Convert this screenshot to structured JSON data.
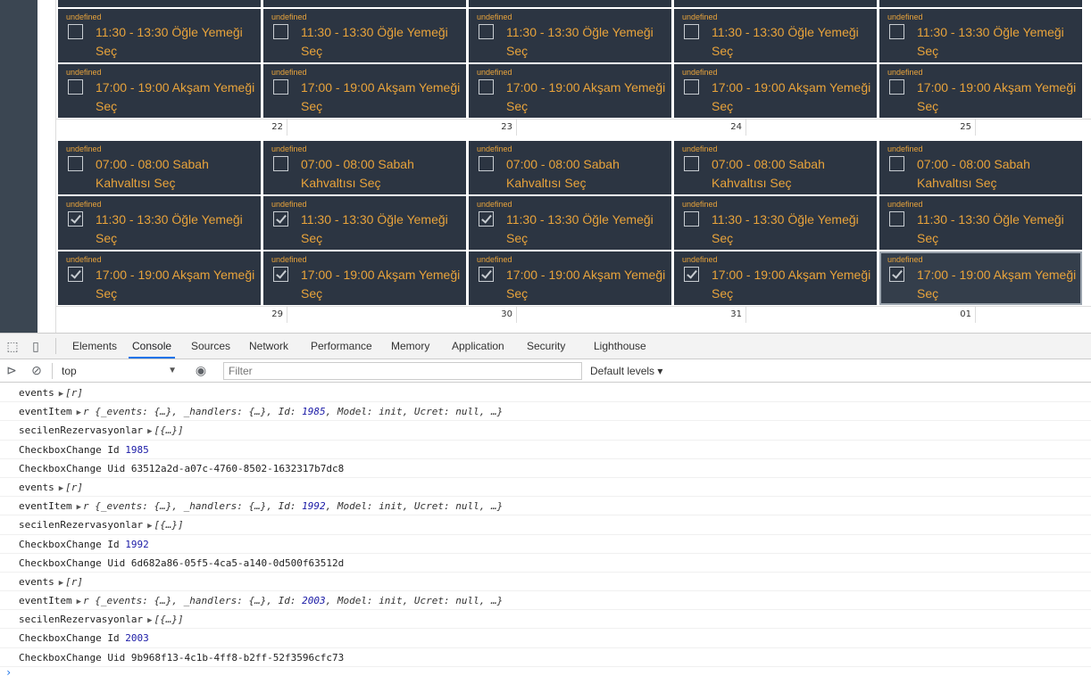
{
  "calendar": {
    "event_tag": "undefined",
    "week1_events": [
      {
        "row": 0,
        "items": [
          {
            "text": "11:30 - 13:30 Öğle Yemeği Seç",
            "checked": false
          },
          {
            "text": "11:30 - 13:30 Öğle Yemeği Seç",
            "checked": false
          },
          {
            "text": "11:30 - 13:30 Öğle Yemeği Seç",
            "checked": false
          },
          {
            "text": "11:30 - 13:30 Öğle Yemeği Seç",
            "checked": false
          },
          {
            "text": "11:30 - 13:30 Öğle Yemeği Seç",
            "checked": false
          }
        ]
      },
      {
        "row": 1,
        "items": [
          {
            "text": "17:00 - 19:00 Akşam Yemeği Seç",
            "checked": false
          },
          {
            "text": "17:00 - 19:00 Akşam Yemeği Seç",
            "checked": false
          },
          {
            "text": "17:00 - 19:00 Akşam Yemeği Seç",
            "checked": false
          },
          {
            "text": "17:00 - 19:00 Akşam Yemeği Seç",
            "checked": false
          },
          {
            "text": "17:00 - 19:00 Akşam Yemeği Seç",
            "checked": false
          }
        ]
      }
    ],
    "day_numbers_1": [
      "22",
      "23",
      "24",
      "25"
    ],
    "week2_events": [
      {
        "row": 0,
        "items": [
          {
            "text": "07:00 - 08:00 Sabah Kahvaltısı Seç",
            "checked": false
          },
          {
            "text": "07:00 - 08:00 Sabah Kahvaltısı Seç",
            "checked": false
          },
          {
            "text": "07:00 - 08:00 Sabah Kahvaltısı Seç",
            "checked": false
          },
          {
            "text": "07:00 - 08:00 Sabah Kahvaltısı Seç",
            "checked": false
          },
          {
            "text": "07:00 - 08:00 Sabah Kahvaltısı Seç",
            "checked": false
          }
        ]
      },
      {
        "row": 1,
        "items": [
          {
            "text": "11:30 - 13:30 Öğle Yemeği Seç",
            "checked": true
          },
          {
            "text": "11:30 - 13:30 Öğle Yemeği Seç",
            "checked": true
          },
          {
            "text": "11:30 - 13:30 Öğle Yemeği Seç",
            "checked": true
          },
          {
            "text": "11:30 - 13:30 Öğle Yemeği Seç",
            "checked": false
          },
          {
            "text": "11:30 - 13:30 Öğle Yemeği Seç",
            "checked": false
          }
        ]
      },
      {
        "row": 2,
        "items": [
          {
            "text": "17:00 - 19:00 Akşam Yemeği Seç",
            "checked": true
          },
          {
            "text": "17:00 - 19:00 Akşam Yemeği Seç",
            "checked": true
          },
          {
            "text": "17:00 - 19:00 Akşam Yemeği Seç",
            "checked": true
          },
          {
            "text": "17:00 - 19:00 Akşam Yemeği Seç",
            "checked": true
          },
          {
            "text": "17:00 - 19:00 Akşam Yemeği Seç",
            "checked": true,
            "selected": true
          }
        ]
      }
    ],
    "day_numbers_2": [
      "29",
      "30",
      "31",
      "01"
    ]
  },
  "devtools": {
    "tabs": [
      "Elements",
      "Console",
      "Sources",
      "Network",
      "Performance",
      "Memory",
      "Application",
      "Security",
      "Lighthouse"
    ],
    "active_tab": "Console",
    "context": "top",
    "filter_placeholder": "Filter",
    "levels": "Default levels ▾",
    "icons": [
      "inspect-icon",
      "device-toolbar-icon",
      "sidebar-toggle-icon",
      "clear-console-icon",
      "eye-icon"
    ],
    "console": [
      {
        "label": "events",
        "expand": true,
        "obj": "[r]"
      },
      {
        "label": "eventItem",
        "expand": true,
        "obj_parts": [
          "r {_events: {…}, _handlers: {…}, Id: ",
          "1985",
          ", Model: ",
          "init",
          ", Ucret: ",
          "null",
          ", …}"
        ]
      },
      {
        "label": "secilenRezervasyonlar",
        "expand": true,
        "obj": "[{…}]"
      },
      {
        "label": "CheckboxChange Id",
        "num": "1985"
      },
      {
        "label": "CheckboxChange Uid",
        "plain": "63512a2d-a07c-4760-8502-1632317b7dc8"
      },
      {
        "label": "events",
        "expand": true,
        "obj": "[r]"
      },
      {
        "label": "eventItem",
        "expand": true,
        "obj_parts": [
          "r {_events: {…}, _handlers: {…}, Id: ",
          "1992",
          ", Model: ",
          "init",
          ", Ucret: ",
          "null",
          ", …}"
        ]
      },
      {
        "label": "secilenRezervasyonlar",
        "expand": true,
        "obj": "[{…}]"
      },
      {
        "label": "CheckboxChange Id",
        "num": "1992"
      },
      {
        "label": "CheckboxChange Uid",
        "plain": "6d682a86-05f5-4ca5-a140-0d500f63512d"
      },
      {
        "label": "events",
        "expand": true,
        "obj": "[r]"
      },
      {
        "label": "eventItem",
        "expand": true,
        "obj_parts": [
          "r {_events: {…}, _handlers: {…}, Id: ",
          "2003",
          ", Model: ",
          "init",
          ", Ucret: ",
          "null",
          ", …}"
        ]
      },
      {
        "label": "secilenRezervasyonlar",
        "expand": true,
        "obj": "[{…}]"
      },
      {
        "label": "CheckboxChange Id",
        "num": "2003"
      },
      {
        "label": "CheckboxChange Uid",
        "plain": "9b968f13-4c1b-4ff8-b2ff-52f3596cfc73"
      }
    ],
    "prompt": "›"
  },
  "colors": {
    "event_bg": "#2c3542",
    "event_text": "#e8a33b",
    "sidebar": "#3b4652",
    "devtools_accent": "#1a73e8"
  }
}
